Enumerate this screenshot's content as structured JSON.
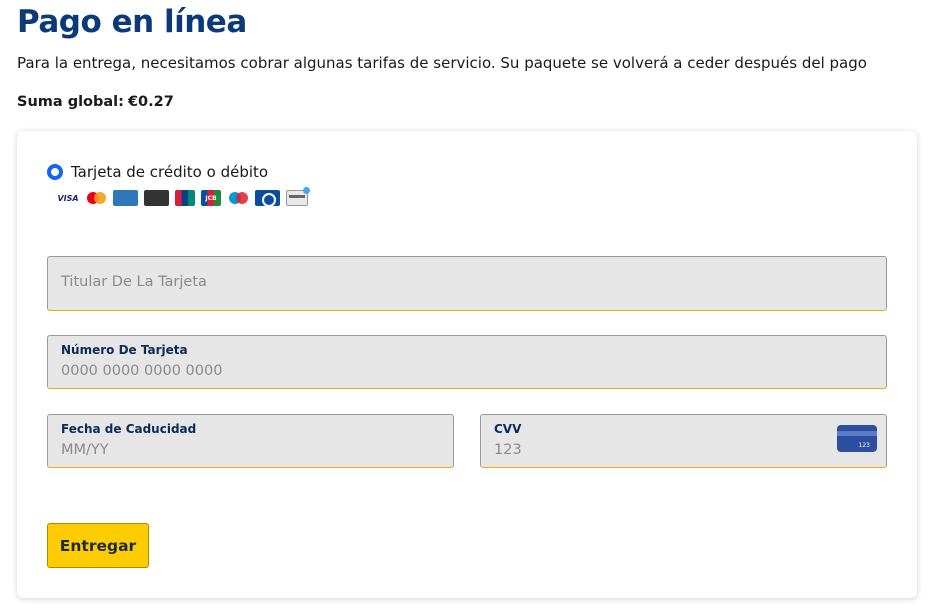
{
  "header": {
    "title": "Pago en línea",
    "subtitle": "Para la entrega, necesitamos cobrar algunas tarifas de servicio. Su paquete se volverá a ceder después del pago",
    "total_label": "Suma global:",
    "total_amount": "€0.27"
  },
  "payment_method": {
    "label": "Tarjeta de crédito o débito",
    "selected": true,
    "accent_color": "#1463f3",
    "card_logos": [
      {
        "name": "visa",
        "text": "VISA"
      },
      {
        "name": "mastercard"
      },
      {
        "name": "american-express",
        "text": "AMERICAN EXPRESS"
      },
      {
        "name": "discover",
        "text": "DISCOVER"
      },
      {
        "name": "unionpay"
      },
      {
        "name": "jcb",
        "text": "JCB"
      },
      {
        "name": "maestro"
      },
      {
        "name": "diners-club"
      },
      {
        "name": "generic-card"
      }
    ]
  },
  "form": {
    "holder": {
      "placeholder": "Titular De La Tarjeta"
    },
    "number": {
      "label": "Número De Tarjeta",
      "placeholder": "0000 0000 0000 0000"
    },
    "expiry": {
      "label": "Fecha de Caducidad",
      "placeholder": "MM/YY"
    },
    "cvv": {
      "label": "CVV",
      "placeholder": "123",
      "icon_text": "123"
    }
  },
  "submit": {
    "label": "Entregar",
    "color": "#ffcc00"
  },
  "colors": {
    "title": "#0b3a7a",
    "field_bg": "#e6e6e6",
    "field_underline": "#e5b400"
  }
}
